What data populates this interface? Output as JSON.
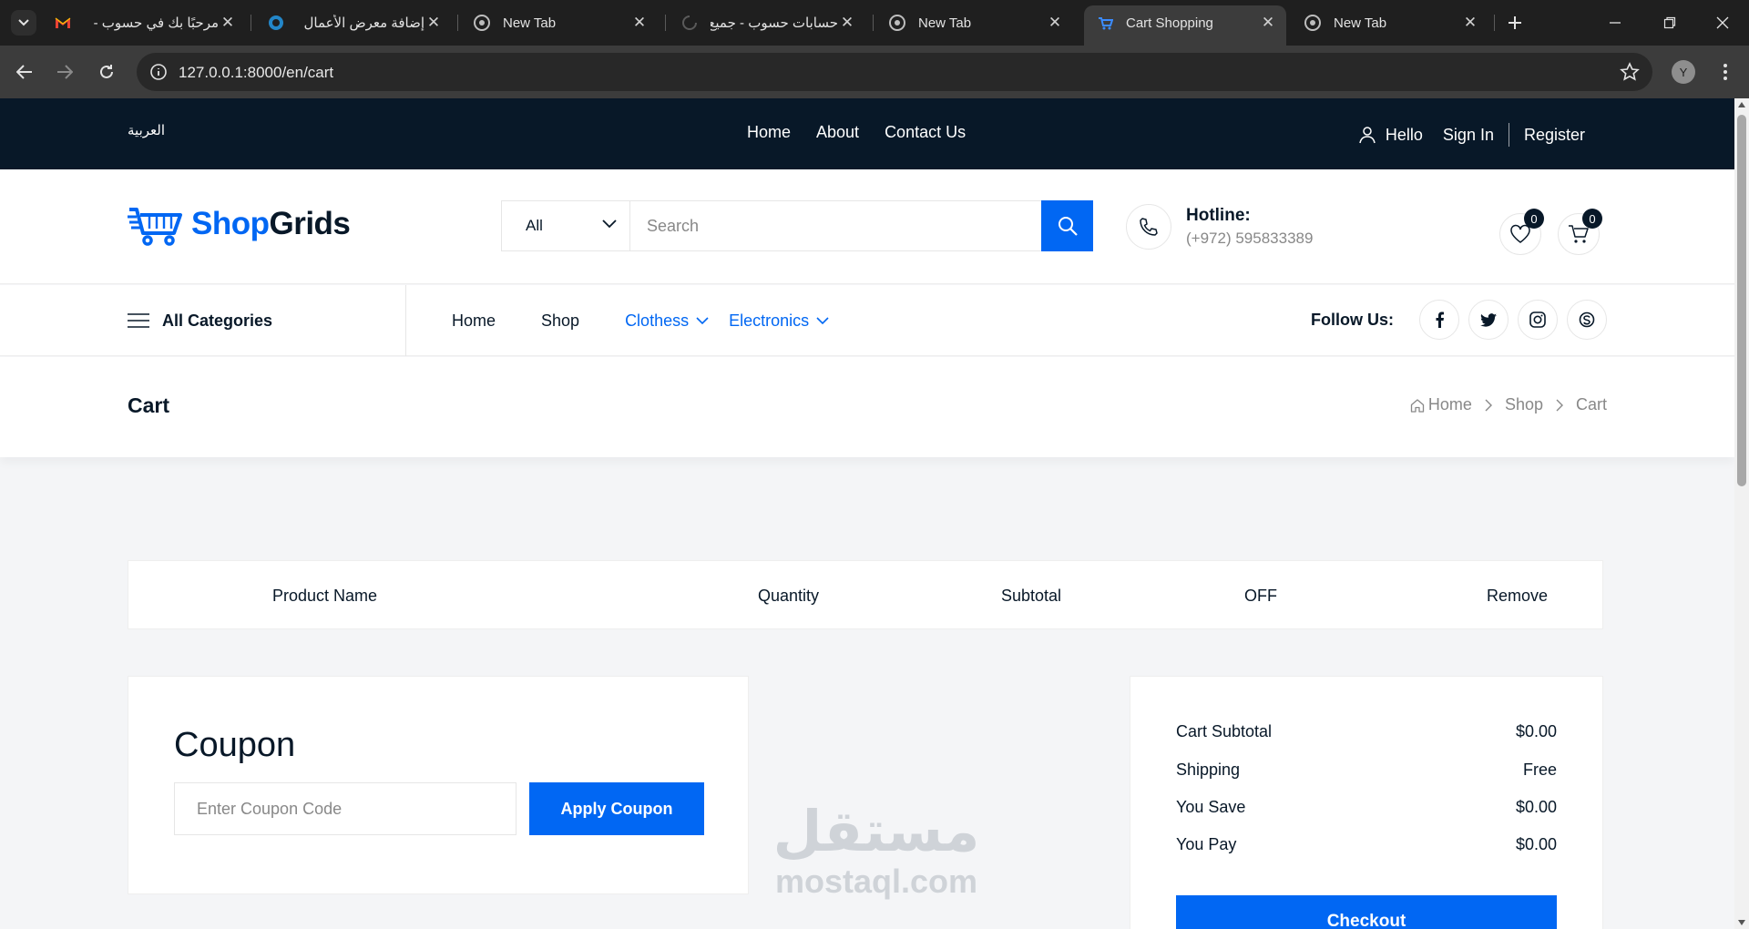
{
  "browser": {
    "tabs": [
      {
        "title": "مرحبًا بك في حسوب -",
        "favicon": "gmail-icon"
      },
      {
        "title": "إضافة معرض الأعمال",
        "favicon": "mostaql-icon"
      },
      {
        "title": "New Tab",
        "favicon": "chrome-icon"
      },
      {
        "title": "حسابات حسوب - جميع",
        "favicon": "loading-icon"
      },
      {
        "title": "New Tab",
        "favicon": "chrome-icon"
      },
      {
        "title": "Cart Shopping",
        "favicon": "shopgrids-icon",
        "active": true
      },
      {
        "title": "New Tab",
        "favicon": "chrome-icon"
      }
    ],
    "url": "127.0.0.1:8000/en/cart",
    "profile_initial": "Y"
  },
  "topbar": {
    "language": "العربية",
    "links": [
      "Home",
      "About",
      "Contact Us"
    ],
    "hello": "Hello",
    "sign_in": "Sign In",
    "register": "Register"
  },
  "header": {
    "logo_shop": "Shop",
    "logo_grids": "Grids",
    "search_category": "All",
    "search_placeholder": "Search",
    "hotline_label": "Hotline:",
    "hotline_number": "(+972) 595833389",
    "wishlist_count": "0",
    "cart_count": "0"
  },
  "nav": {
    "all_categories": "All Categories",
    "items": [
      "Home",
      "Shop",
      "Clothess",
      "Electronics"
    ],
    "follow_us": "Follow Us:"
  },
  "breadcrumbs": {
    "page_title": "Cart",
    "trail": [
      "Home",
      "Shop",
      "Cart"
    ]
  },
  "cart": {
    "columns": [
      "Product Name",
      "Quantity",
      "Subtotal",
      "OFF",
      "Remove"
    ]
  },
  "coupon": {
    "title": "Coupon",
    "placeholder": "Enter Coupon Code",
    "apply_label": "Apply Coupon"
  },
  "summary": {
    "rows": [
      {
        "label": "Cart Subtotal",
        "value": "$0.00"
      },
      {
        "label": "Shipping",
        "value": "Free"
      },
      {
        "label": "You Save",
        "value": "$0.00"
      },
      {
        "label": "You Pay",
        "value": "$0.00"
      }
    ],
    "checkout_label": "Checkout"
  },
  "watermark": {
    "arabic": "مستقل",
    "latin": "mostaql.com"
  },
  "colors": {
    "primary": "#0167f3",
    "dark": "#081828"
  }
}
